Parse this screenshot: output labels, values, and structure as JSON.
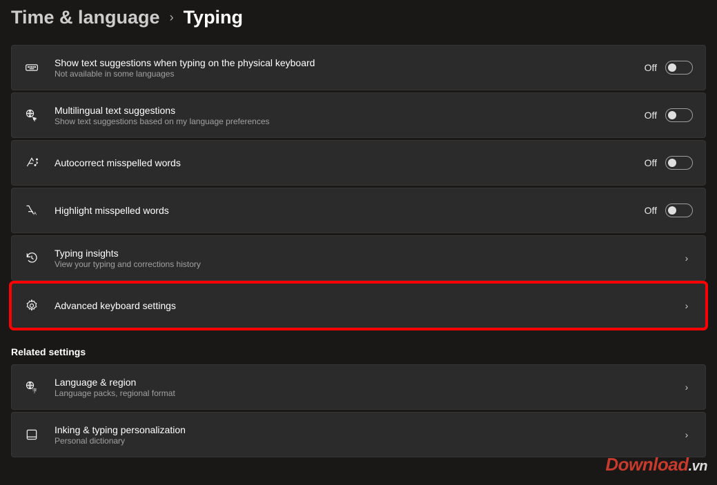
{
  "breadcrumb": {
    "parent": "Time & language",
    "current": "Typing"
  },
  "off_label": "Off",
  "items": [
    {
      "icon": "keyboard-icon",
      "title": "Show text suggestions when typing on the physical keyboard",
      "subtitle": "Not available in some languages",
      "type": "toggle",
      "state": "Off"
    },
    {
      "icon": "globe-translate-icon",
      "title": "Multilingual text suggestions",
      "subtitle": "Show text suggestions based on my language preferences",
      "type": "toggle",
      "state": "Off"
    },
    {
      "icon": "autocorrect-icon",
      "title": "Autocorrect misspelled words",
      "subtitle": "",
      "type": "toggle",
      "state": "Off"
    },
    {
      "icon": "spellcheck-icon",
      "title": "Highlight misspelled words",
      "subtitle": "",
      "type": "toggle",
      "state": "Off"
    },
    {
      "icon": "history-icon",
      "title": "Typing insights",
      "subtitle": "View your typing and corrections history",
      "type": "link"
    },
    {
      "icon": "gear-icon",
      "title": "Advanced keyboard settings",
      "subtitle": "",
      "type": "link",
      "highlight": true
    }
  ],
  "related": {
    "heading": "Related settings",
    "items": [
      {
        "icon": "globe-translate-icon",
        "title": "Language & region",
        "subtitle": "Language packs, regional format",
        "type": "link"
      },
      {
        "icon": "tablet-icon",
        "title": "Inking & typing personalization",
        "subtitle": "Personal dictionary",
        "type": "link"
      }
    ]
  },
  "watermark": {
    "a": "Download",
    "b": ".vn"
  }
}
